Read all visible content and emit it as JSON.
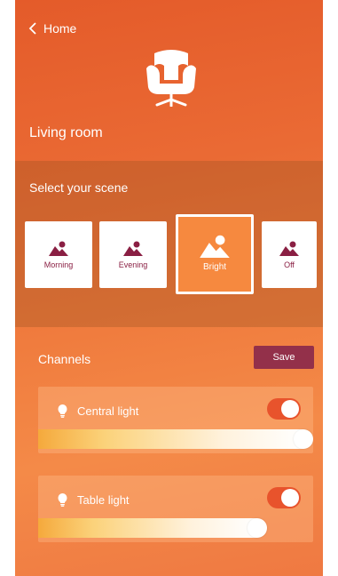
{
  "nav": {
    "back_label": "Home"
  },
  "room": {
    "title": "Living room",
    "icon": "armchair-icon"
  },
  "scenes": {
    "label": "Select your scene",
    "items": [
      {
        "label": "Morning",
        "icon": "scene-image-icon",
        "active": false
      },
      {
        "label": "Evening",
        "icon": "scene-image-icon",
        "active": false
      },
      {
        "label": "Bright",
        "icon": "scene-image-icon",
        "active": true
      },
      {
        "label": "Off",
        "icon": "scene-image-icon",
        "active": false
      }
    ]
  },
  "channels": {
    "label": "Channels",
    "save_label": "Save",
    "items": [
      {
        "name": "Central light",
        "icon": "bulb-icon",
        "on": true,
        "level": 1.0
      },
      {
        "name": "Table light",
        "icon": "bulb-icon",
        "on": true,
        "level": 0.82
      }
    ]
  },
  "colors": {
    "accent": "#93304a",
    "scene_icon": "#8a1f43",
    "active_scene": "#f6893f",
    "toggle": "#e8532c"
  }
}
